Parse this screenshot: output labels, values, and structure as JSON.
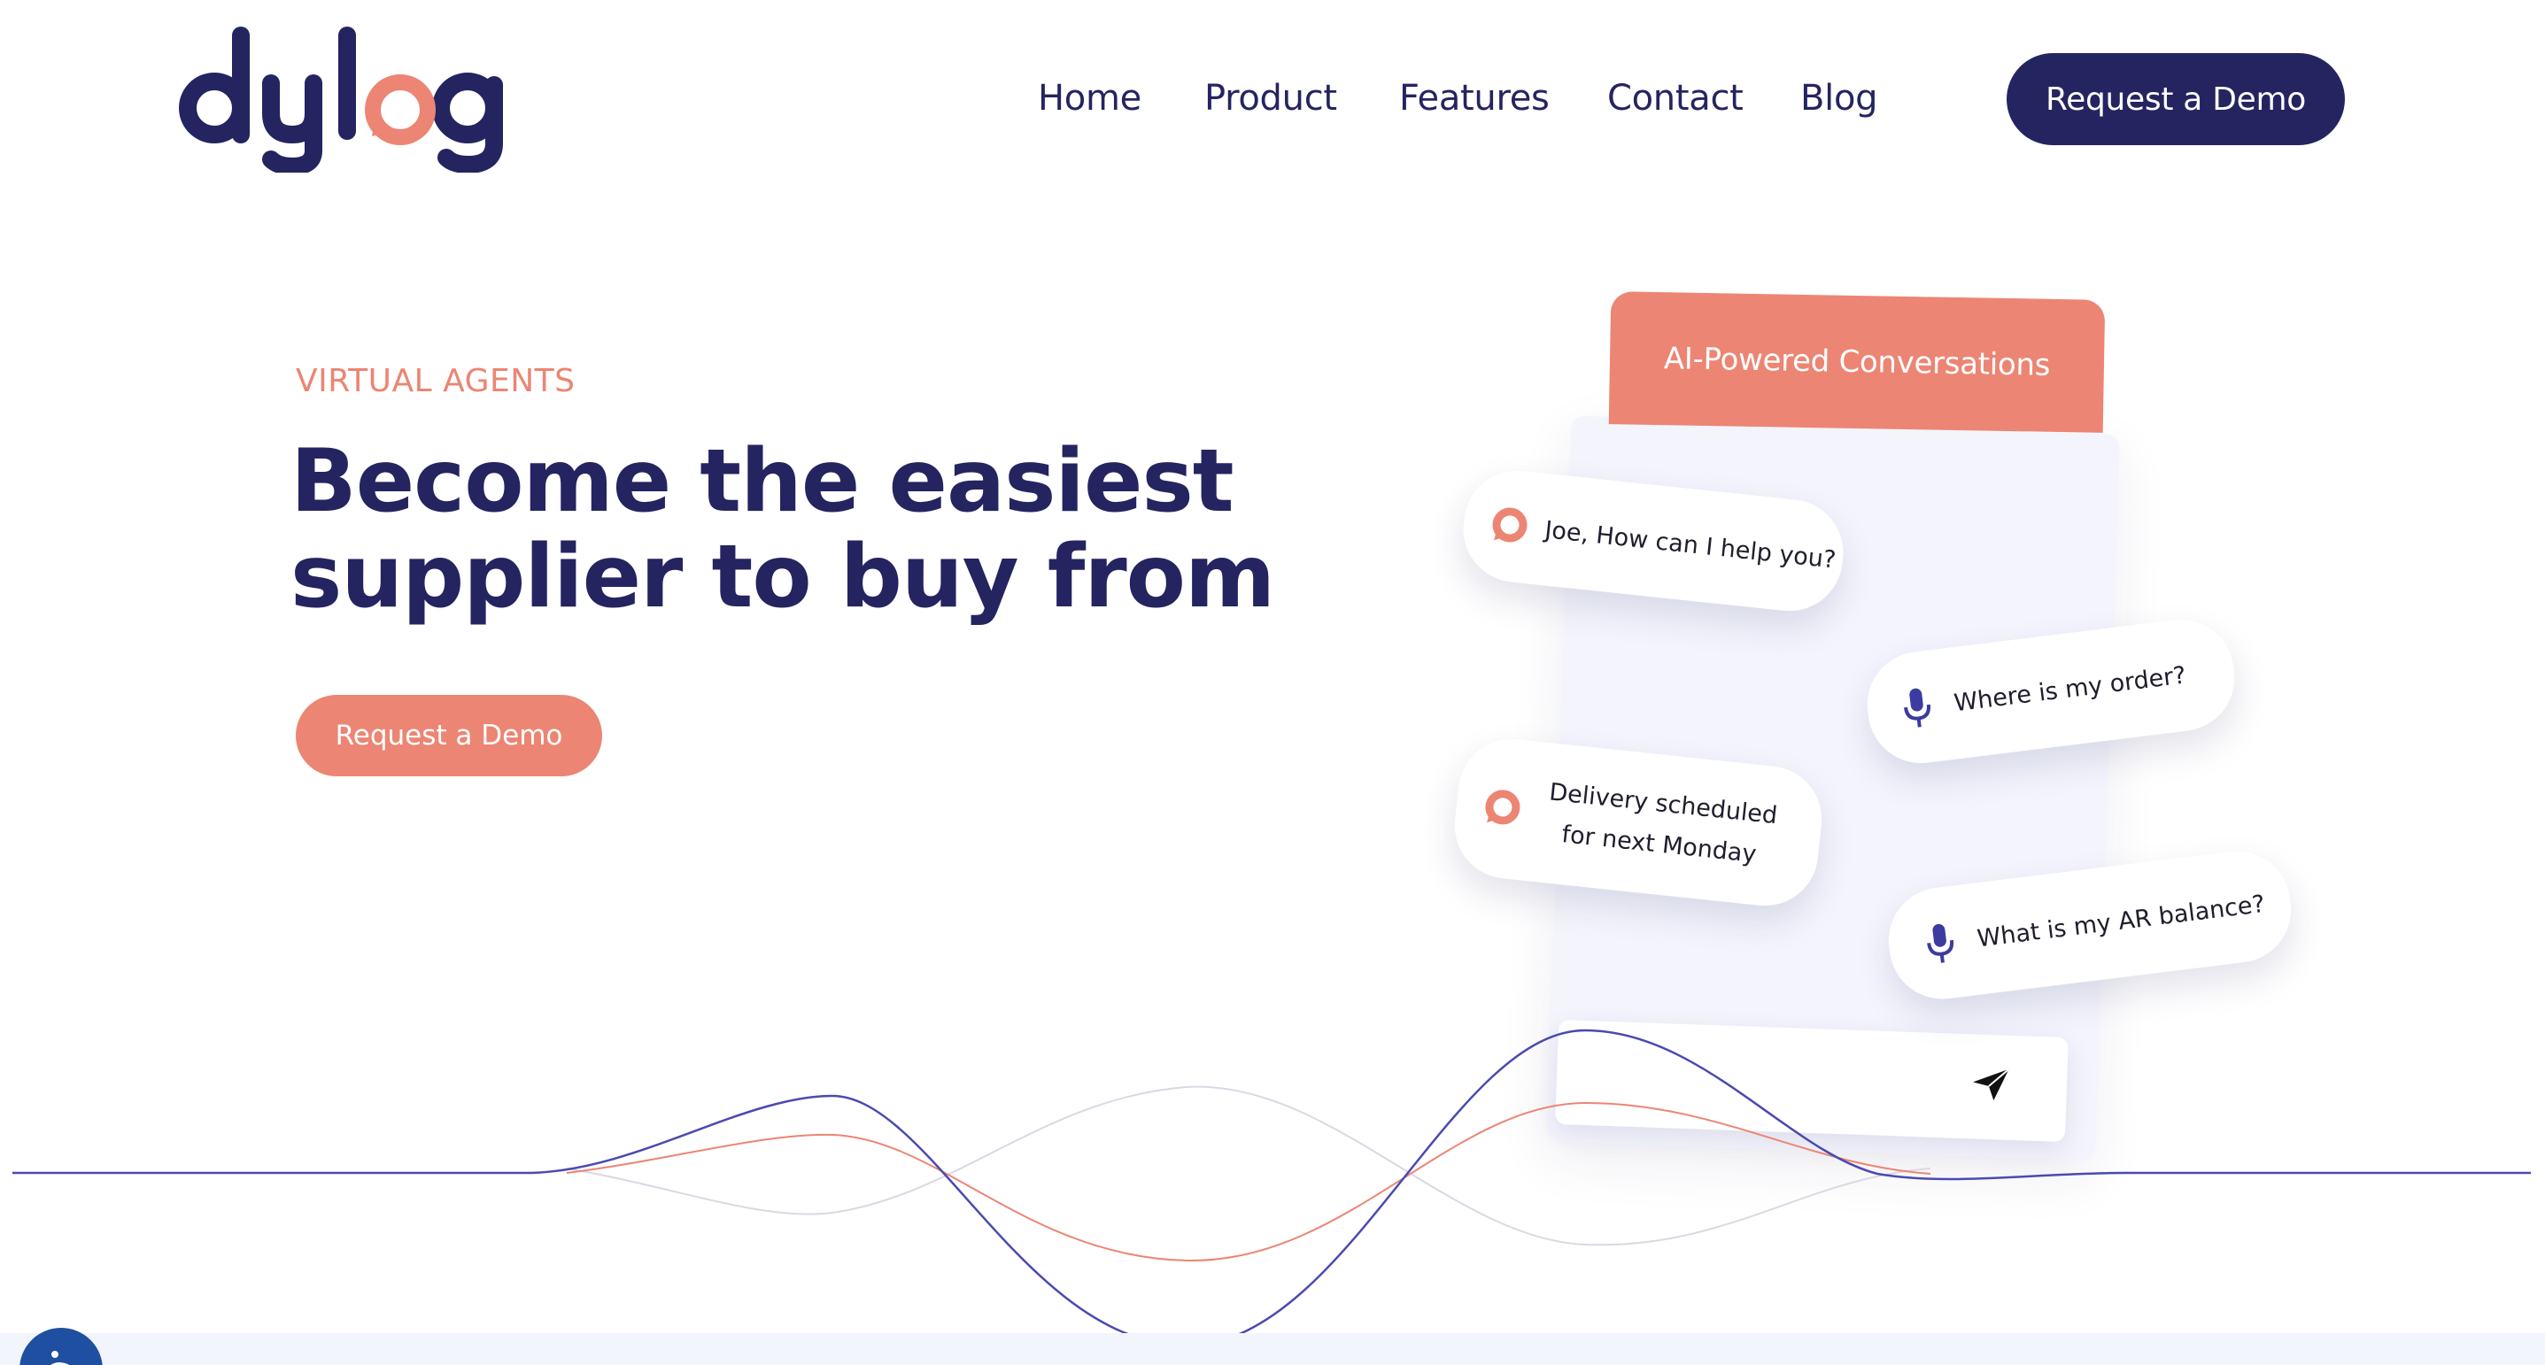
{
  "brand": {
    "name": "dylog",
    "colors": {
      "navy": "#242461",
      "coral": "#ec8573",
      "panel": "#f3f4fc"
    }
  },
  "nav": {
    "items": [
      "Home",
      "Product",
      "Features",
      "Contact",
      "Blog"
    ],
    "cta_label": "Request a Demo"
  },
  "hero": {
    "eyebrow": "VIRTUAL AGENTS",
    "headline_line1": "Become the easiest",
    "headline_line2": "supplier to buy from",
    "cta_label": "Request a Demo"
  },
  "chat_mock": {
    "header_title": "AI-Powered Conversations",
    "messages": [
      {
        "text": "Joe, How can I help you?",
        "icon": "chat-bubble-icon"
      },
      {
        "text": "Where is my order?",
        "icon": "microphone-icon"
      },
      {
        "text": "Delivery scheduled for next Monday",
        "icon": "chat-bubble-icon"
      },
      {
        "text": "What is my AR balance?",
        "icon": "microphone-icon"
      }
    ],
    "send_icon": "send-arrow-icon"
  },
  "accessibility": {
    "icon": "accessibility-icon"
  }
}
